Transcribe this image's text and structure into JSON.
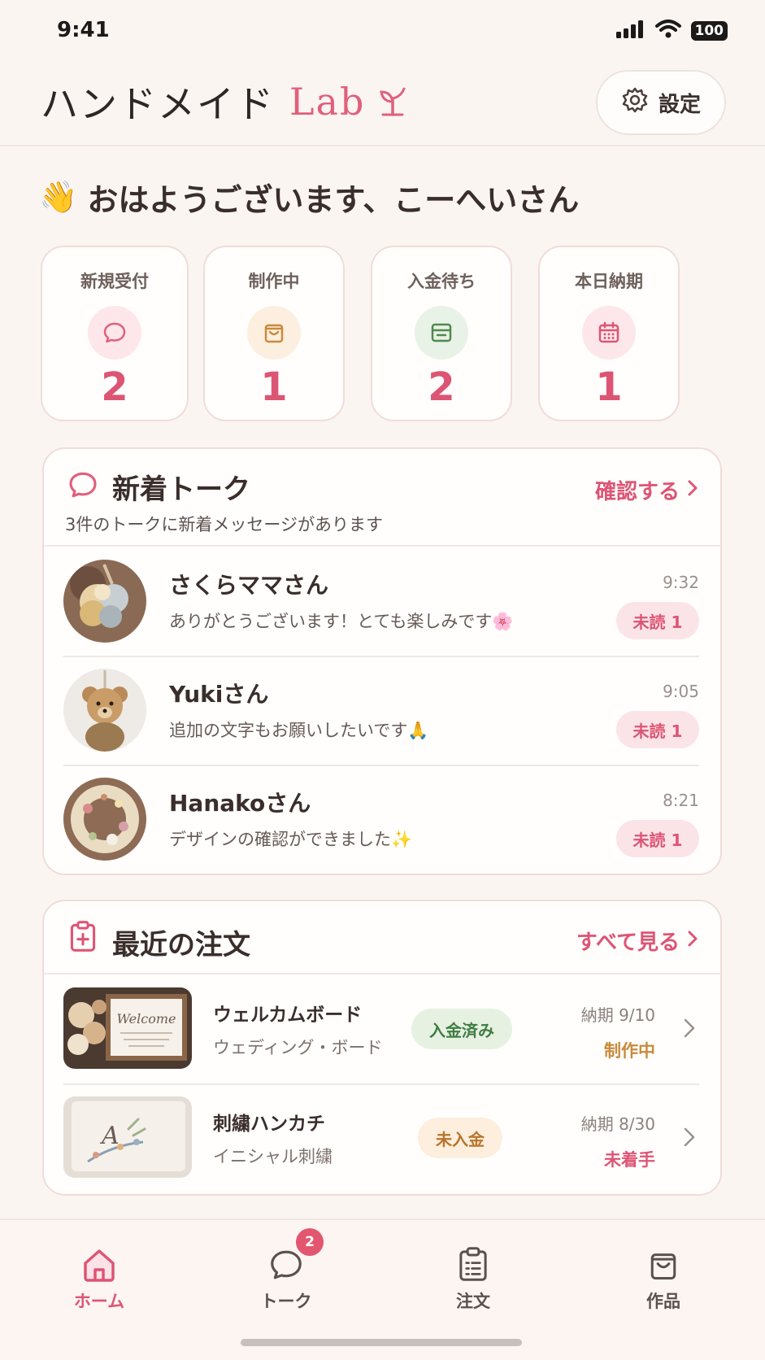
{
  "status_bar": {
    "time": "9:41",
    "battery": "100"
  },
  "header": {
    "title": "ハンドメイド",
    "title_accent": "Lab",
    "settings_label": "設定"
  },
  "greeting": {
    "emoji": "👋",
    "text": "おはようございます、こーへいさん"
  },
  "stats": [
    {
      "label": "新規受付",
      "value": "2",
      "icon": "chat-icon",
      "icon_color": "#e0607c",
      "icon_bg": "#fde7ea"
    },
    {
      "label": "制作中",
      "value": "1",
      "icon": "bag-icon",
      "icon_color": "#c98a3a",
      "icon_bg": "#fcefdf"
    },
    {
      "label": "入金待ち",
      "value": "2",
      "icon": "wallet-icon",
      "icon_color": "#4f8a4e",
      "icon_bg": "#e9f2e6"
    },
    {
      "label": "本日納期",
      "value": "1",
      "icon": "calendar-icon",
      "icon_color": "#dd5574",
      "icon_bg": "#fde7ea"
    }
  ],
  "talks": {
    "title": "新着トーク",
    "subtitle": "3件のトークに新着メッセージがあります",
    "link": "確認する",
    "items": [
      {
        "name": "さくらママさん",
        "message": "ありがとうございます！とても楽しみです🌸",
        "time": "9:32",
        "badge": "未読 1"
      },
      {
        "name": "Yukiさん",
        "message": "追加の文字もお願いしたいです🙏",
        "time": "9:05",
        "badge": "未読 1"
      },
      {
        "name": "Hanakoさん",
        "message": "デザインの確認ができました✨",
        "time": "8:21",
        "badge": "未読 1"
      }
    ]
  },
  "orders": {
    "title": "最近の注文",
    "link": "すべて見る",
    "items": [
      {
        "name": "ウェルカムボード",
        "category": "ウェディング・ボード",
        "payment": "入金済み",
        "payment_color": "#3f7d42",
        "payment_bg": "#e6f1e2",
        "due": "納期 9/10",
        "status": "制作中",
        "status_color": "#c98a3a",
        "thumb_text": "Welcome"
      },
      {
        "name": "刺繍ハンカチ",
        "category": "イニシャル刺繍",
        "payment": "未入金",
        "payment_color": "#b8742a",
        "payment_bg": "#fdeedd",
        "due": "納期 8/30",
        "status": "未着手",
        "status_color": "#dd5574",
        "thumb_text": "A"
      }
    ]
  },
  "tabbar": {
    "items": [
      {
        "label": "ホーム",
        "icon": "home-icon"
      },
      {
        "label": "トーク",
        "icon": "chat-icon",
        "badge": "2"
      },
      {
        "label": "注文",
        "icon": "clipboard-icon"
      },
      {
        "label": "作品",
        "icon": "bag-icon"
      }
    ]
  },
  "colors": {
    "accent": "#dd5574",
    "background": "#fbf5f2",
    "card": "#fffefd"
  }
}
